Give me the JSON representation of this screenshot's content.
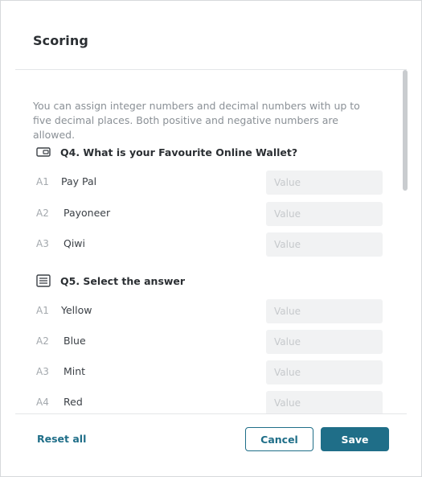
{
  "dialog": {
    "title": "Scoring",
    "description": "You can assign integer numbers and decimal numbers with up to five decimal places. Both positive and negative numbers are allowed."
  },
  "questions": [
    {
      "title": "Q4. What is your Favourite Online Wallet?",
      "icon": "wallet-icon",
      "answers": [
        {
          "code": "A1",
          "label": "Pay Pal",
          "value": "",
          "placeholder": "Value"
        },
        {
          "code": "A2",
          "label": "Payoneer",
          "value": "",
          "placeholder": "Value"
        },
        {
          "code": "A3",
          "label": "Qiwi",
          "value": "",
          "placeholder": "Value"
        }
      ]
    },
    {
      "title": "Q5. Select the answer",
      "icon": "list-icon",
      "answers": [
        {
          "code": "A1",
          "label": "Yellow",
          "value": "",
          "placeholder": "Value"
        },
        {
          "code": "A2",
          "label": "Blue",
          "value": "",
          "placeholder": "Value"
        },
        {
          "code": "A3",
          "label": "Mint",
          "value": "",
          "placeholder": "Value"
        },
        {
          "code": "A4",
          "label": "Red",
          "value": "",
          "placeholder": "Value"
        }
      ]
    }
  ],
  "footer": {
    "reset_label": "Reset all",
    "cancel_label": "Cancel",
    "save_label": "Save"
  },
  "colors": {
    "accent": "#1f6e88",
    "input_bg": "#f1f2f3",
    "muted_text": "#8a9096"
  }
}
